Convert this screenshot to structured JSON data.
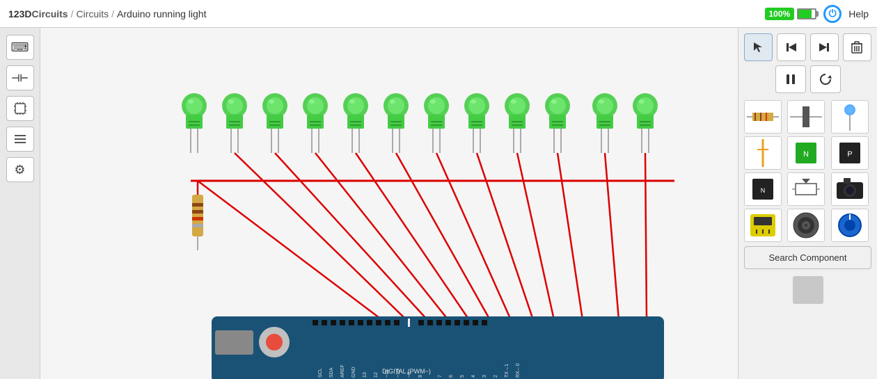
{
  "topbar": {
    "brand": "123D",
    "brand_suffix": "Circuits",
    "sep1": "/",
    "link1": "Circuits",
    "sep2": "/",
    "page_title": "Arduino running light",
    "battery_pct": "100%",
    "help_label": "Help"
  },
  "sidebar": {
    "items": [
      {
        "id": "keyboard",
        "icon": "⌨",
        "label": "keyboard-icon"
      },
      {
        "id": "component",
        "icon": "⊣⊢",
        "label": "component-icon"
      },
      {
        "id": "chip",
        "icon": "▤",
        "label": "chip-icon"
      },
      {
        "id": "list",
        "icon": "≡",
        "label": "list-icon"
      },
      {
        "id": "settings",
        "icon": "⚙",
        "label": "settings-icon"
      }
    ]
  },
  "controls": {
    "row1": [
      {
        "id": "select",
        "icon": "↖",
        "label": "select-tool"
      },
      {
        "id": "step-back",
        "icon": "⏮",
        "label": "step-back-button"
      },
      {
        "id": "step-fwd",
        "icon": "⏭",
        "label": "step-forward-button"
      },
      {
        "id": "delete",
        "icon": "🗑",
        "label": "delete-button"
      }
    ],
    "row2": [
      {
        "id": "pause",
        "icon": "⏸",
        "label": "pause-button"
      },
      {
        "id": "rotate",
        "icon": "↺",
        "label": "rotate-button"
      }
    ]
  },
  "components": {
    "grid": [
      {
        "id": "resistor",
        "label": "resistor-component"
      },
      {
        "id": "capacitor",
        "label": "capacitor-component"
      },
      {
        "id": "diode",
        "label": "diode-component"
      },
      {
        "id": "power",
        "label": "power-component"
      },
      {
        "id": "transistor-n",
        "label": "transistor-n-component"
      },
      {
        "id": "transistor-p",
        "label": "transistor-p-component"
      },
      {
        "id": "transistor-npn",
        "label": "transistor-npn-component"
      },
      {
        "id": "potentiometer",
        "label": "potentiometer-component"
      },
      {
        "id": "camera",
        "label": "camera-component"
      },
      {
        "id": "multimeter",
        "label": "multimeter-component"
      },
      {
        "id": "speaker",
        "label": "speaker-component"
      },
      {
        "id": "rotary",
        "label": "rotary-component"
      }
    ],
    "search_label": "Search Component"
  },
  "circuit": {
    "title": "Arduino running light",
    "led_count": 12,
    "wire_color": "#dd0000"
  }
}
